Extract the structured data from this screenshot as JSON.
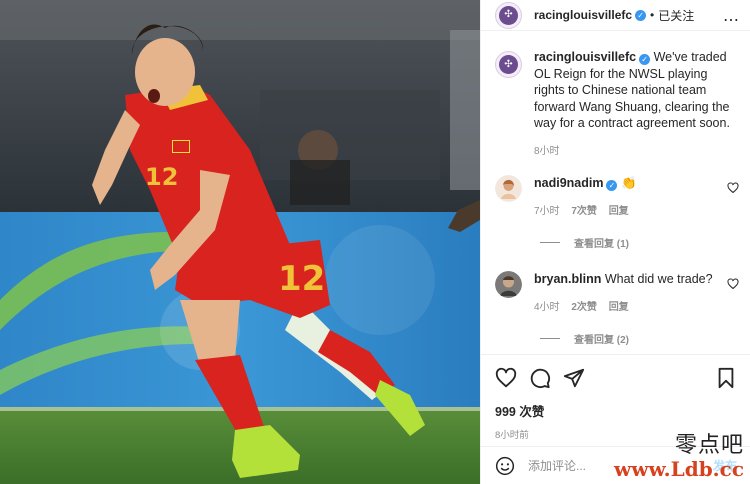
{
  "header": {
    "username": "racinglouisvillefc",
    "separator": "•",
    "following_label": "已关注",
    "more_icon": "…"
  },
  "caption": {
    "username": "racinglouisvillefc",
    "text": "We've traded OL Reign for the NWSL playing rights to Chinese national team forward Wang Shuang, clearing the way for a contract agreement soon.",
    "time": "8小时"
  },
  "comments": [
    {
      "username": "nadi9nadim",
      "text": "👏",
      "time": "7小时",
      "likes": "7次赞",
      "reply_label": "回复",
      "view_replies": "查看回复 (1)"
    },
    {
      "username": "bryan.blinn",
      "text": "What did we trade?",
      "time": "4小时",
      "likes": "2次赞",
      "reply_label": "回复",
      "view_replies": "查看回复 (2)"
    }
  ],
  "actions": {
    "like_count": "999 次赞",
    "time": "8小时前"
  },
  "add_comment": {
    "placeholder": "添加评论...",
    "post_label": "发布"
  },
  "photo": {
    "jersey_number": "12"
  },
  "watermark": {
    "line1": "零点吧",
    "line2": "www.Ldb.cc"
  },
  "colors": {
    "verified": "#3897f0",
    "jersey": "#d8231f",
    "grass": "#3f7d2f",
    "ad_board": "#2f86c8"
  }
}
